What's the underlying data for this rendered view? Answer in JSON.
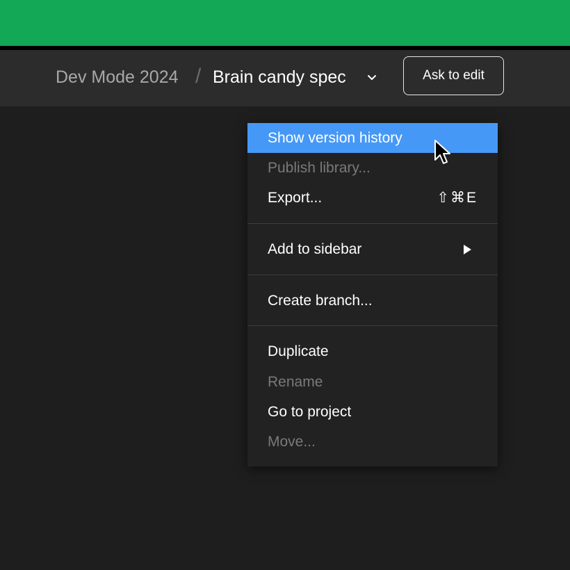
{
  "header": {
    "project_name": "Dev Mode 2024",
    "separator": "/",
    "file_name": "Brain candy spec",
    "ask_to_edit_label": "Ask to edit"
  },
  "menu": {
    "items": [
      {
        "label": "Show version history",
        "state": "highlighted"
      },
      {
        "label": "Publish library...",
        "state": "disabled"
      },
      {
        "label": "Export...",
        "shortcut": "⇧⌘E",
        "state": "enabled"
      },
      {
        "label": "Add to sidebar",
        "submenu": true,
        "state": "enabled"
      },
      {
        "label": "Create branch...",
        "state": "enabled"
      },
      {
        "label": "Duplicate",
        "state": "enabled"
      },
      {
        "label": "Rename",
        "state": "disabled"
      },
      {
        "label": "Go to project",
        "state": "enabled"
      },
      {
        "label": "Move...",
        "state": "disabled"
      }
    ]
  },
  "colors": {
    "top_bar": "#12a856",
    "header_bg": "#2c2c2c",
    "canvas_bg": "#1e1e1e",
    "menu_bg": "#222222",
    "highlight": "#4698f7",
    "disabled_text": "#7a7a7a"
  },
  "icons": {
    "breadcrumb_chevron": "chevron-down-icon",
    "submenu": "play-triangle-icon",
    "pointer": "mouse-cursor-icon"
  }
}
